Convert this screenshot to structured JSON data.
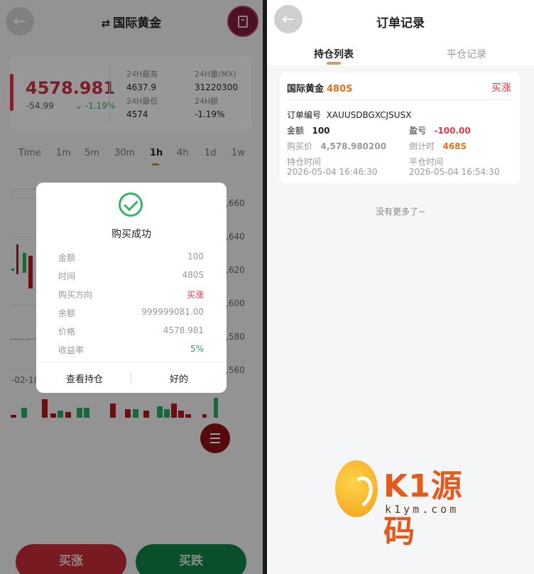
{
  "left": {
    "header": {
      "title": "国际黄金",
      "swap_icon": "⇄"
    },
    "quote": {
      "price": "4578.981",
      "change": "-54.99",
      "change_pct": "-1.19%",
      "stats": [
        {
          "label": "24H最高",
          "value": "4637.9"
        },
        {
          "label": "24H量(MX)",
          "value": "31220300"
        },
        {
          "label": "24H最低",
          "value": "4574"
        },
        {
          "label": "24H额",
          "value": "-1.19%"
        }
      ]
    },
    "timeframes": [
      "Time",
      "1m",
      "5m",
      "30m",
      "1h",
      "4h",
      "1d",
      "1w"
    ],
    "active_timeframe": "1h",
    "chart": {
      "y_ticks": [
        ",660",
        ",640",
        ",620",
        ",600",
        ",580",
        ",560"
      ],
      "x_label": "-02-18"
    },
    "buttons": {
      "buy_up": "买涨",
      "buy_down": "买跌"
    },
    "modal": {
      "title": "购买成功",
      "rows": [
        {
          "label": "金额",
          "value": "100",
          "tone": "gray"
        },
        {
          "label": "时间",
          "value": "480S",
          "tone": "gray"
        },
        {
          "label": "购买方向",
          "value": "买涨",
          "tone": "red"
        },
        {
          "label": "余额",
          "value": "999999081.00",
          "tone": "gray"
        },
        {
          "label": "价格",
          "value": "4578.981",
          "tone": "gray"
        },
        {
          "label": "收益率",
          "value": "5%",
          "tone": "green"
        }
      ],
      "view_positions": "查看持仓",
      "ok": "好的"
    }
  },
  "right": {
    "header": {
      "title": "订单记录"
    },
    "tabs": [
      "持仓列表",
      "平仓记录"
    ],
    "order": {
      "name": "国际黄金",
      "duration": "480S",
      "direction": "买涨",
      "order_no_label": "订单编号",
      "order_no": "XAUUSDBGXCJSUSX",
      "amount_label": "金额",
      "amount": "100",
      "pnl_label": "盈亏",
      "pnl": "-100.00",
      "buy_price_label": "购买价",
      "buy_price": "4,578.980200",
      "countdown_label": "倒计时",
      "countdown": "468S",
      "open_time_label": "持仓时间",
      "open_time": "2026-05-04 16:46:30",
      "close_time_label": "平仓时间",
      "close_time": "2026-05-04 16:54:30"
    },
    "no_more": "没有更多了~"
  },
  "watermark": {
    "brand": "K1源码",
    "url": "k1ym.com"
  },
  "colors": {
    "up_red": "#c12b38",
    "down_green": "#0e8045",
    "accent_orange": "#e2741f",
    "success_green": "#34b36a"
  }
}
